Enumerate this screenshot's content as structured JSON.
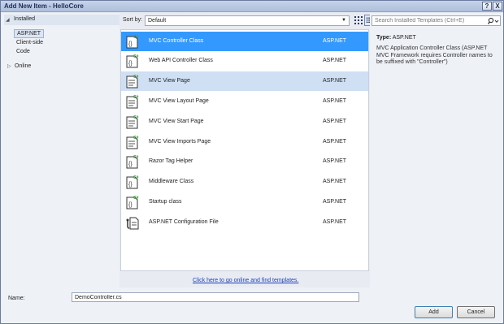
{
  "window": {
    "title": "Add New Item - HelloCore",
    "help_label": "?",
    "close_label": "X"
  },
  "tree": {
    "installed": "Installed",
    "children": [
      "ASP.NET",
      "Client-side",
      "Code"
    ],
    "online": "Online"
  },
  "toolbar": {
    "sort_label": "Sort by:",
    "sort_value": "Default"
  },
  "templates": [
    {
      "name": "MVC Controller Class",
      "category": "ASP.NET",
      "icon": "csharp-class-icon"
    },
    {
      "name": "Web API Controller Class",
      "category": "ASP.NET",
      "icon": "csharp-class-icon"
    },
    {
      "name": "MVC View Page",
      "category": "ASP.NET",
      "icon": "csharp-page-icon"
    },
    {
      "name": "MVC View Layout Page",
      "category": "ASP.NET",
      "icon": "csharp-page-icon"
    },
    {
      "name": "MVC View Start Page",
      "category": "ASP.NET",
      "icon": "csharp-page-icon"
    },
    {
      "name": "MVC View Imports Page",
      "category": "ASP.NET",
      "icon": "csharp-page-icon"
    },
    {
      "name": "Razor Tag Helper",
      "category": "ASP.NET",
      "icon": "csharp-class-icon"
    },
    {
      "name": "Middleware Class",
      "category": "ASP.NET",
      "icon": "csharp-class-icon"
    },
    {
      "name": "Startup class",
      "category": "ASP.NET",
      "icon": "csharp-class-icon"
    },
    {
      "name": "ASP.NET Configuration File",
      "category": "ASP.NET",
      "icon": "config-file-icon"
    }
  ],
  "details": {
    "type_label": "Type:",
    "type_value": "ASP.NET",
    "description": "MVC Application Controller Class (ASP.NET MVC Framework requires Controller names to be suffixed with \"Controller\")"
  },
  "search": {
    "placeholder": "Search Installed Templates (Ctrl+E)"
  },
  "online_link": "Click here to go online and find templates.",
  "footer": {
    "name_label": "Name:",
    "name_value": "DemoController.cs",
    "add_label": "Add",
    "cancel_label": "Cancel"
  },
  "colors": {
    "selection": "#3399ff",
    "hover": "#cfe0f5",
    "link": "#1b3fbf"
  }
}
